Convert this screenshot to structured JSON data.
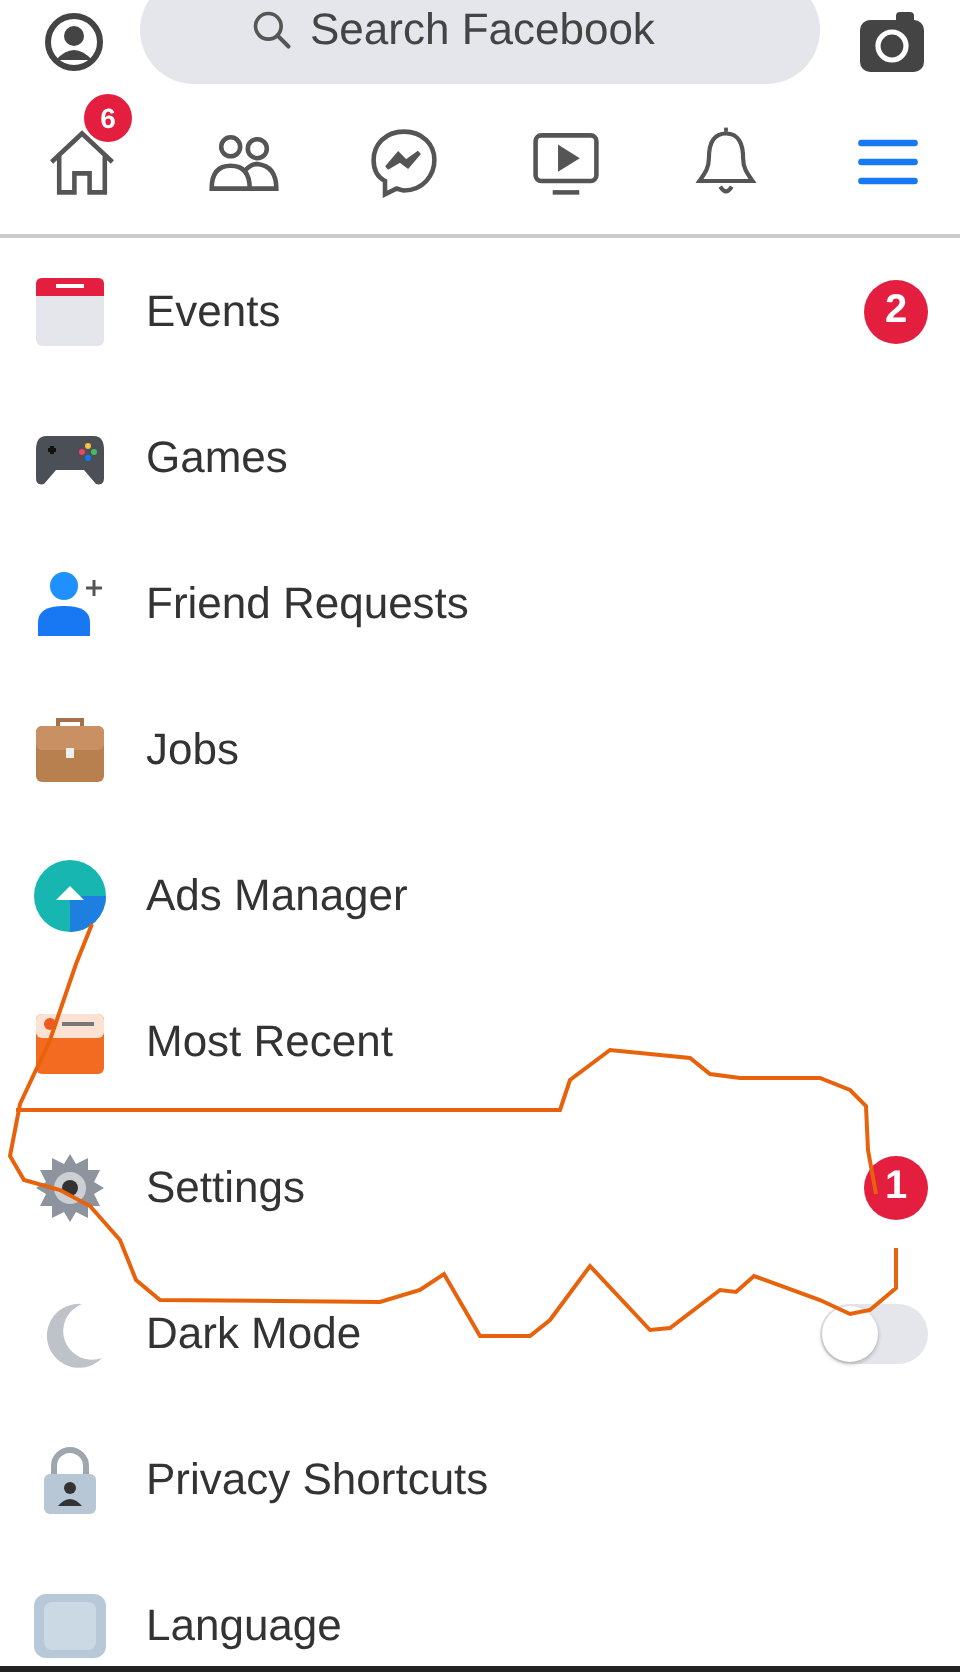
{
  "search": {
    "placeholder": "Search Facebook"
  },
  "tabs": [
    {
      "kind": "home",
      "selected": false,
      "badge": "6"
    },
    {
      "kind": "friends",
      "selected": false
    },
    {
      "kind": "messenger",
      "selected": false
    },
    {
      "kind": "watch",
      "selected": false
    },
    {
      "kind": "notifications",
      "selected": false
    },
    {
      "kind": "menu",
      "selected": true
    }
  ],
  "menu_items": [
    {
      "label": "Events",
      "kind": "badge",
      "badge": "2"
    },
    {
      "label": "Games",
      "kind": "plain"
    },
    {
      "label": "Friend Requests",
      "kind": "plain"
    },
    {
      "label": "Jobs",
      "kind": "plain"
    },
    {
      "label": "Ads Manager",
      "kind": "plain"
    },
    {
      "label": "Most Recent",
      "kind": "plain"
    },
    {
      "label": "Settings",
      "kind": "badge",
      "badge": "1"
    },
    {
      "label": "Dark Mode",
      "kind": "toggle",
      "on": false
    },
    {
      "label": "Privacy Shortcuts",
      "kind": "plain"
    },
    {
      "label": "Language",
      "kind": "plain"
    }
  ],
  "annotation": {
    "kind": "freehand"
  }
}
